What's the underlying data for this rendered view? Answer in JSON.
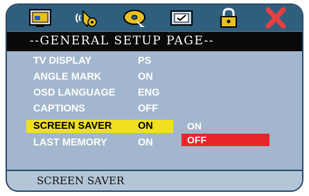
{
  "toolbar": {
    "icons": [
      "general-setup-icon",
      "audio-setup-icon",
      "disc-setup-icon",
      "preference-icon",
      "password-lock-icon",
      "exit-icon"
    ],
    "colors": {
      "bar": "#2f5f7d",
      "panel": "#a2b7cd",
      "highlight": "#f0e020",
      "option_selected": "#e8262a"
    }
  },
  "page": {
    "title": "--GENERAL SETUP PAGE--"
  },
  "menu": {
    "items": [
      {
        "label": "TV DISPLAY",
        "value": "PS"
      },
      {
        "label": "ANGLE MARK",
        "value": "ON"
      },
      {
        "label": "OSD LANGUAGE",
        "value": "ENG"
      },
      {
        "label": "CAPTIONS",
        "value": "OFF"
      },
      {
        "label": "SCREEN SAVER",
        "value": "ON"
      },
      {
        "label": "LAST MEMORY",
        "value": "ON"
      }
    ],
    "selected_index": 4
  },
  "submenu": {
    "options": [
      "ON",
      "OFF"
    ],
    "selected": "OFF"
  },
  "footer": {
    "text": "SCREEN SAVER"
  }
}
